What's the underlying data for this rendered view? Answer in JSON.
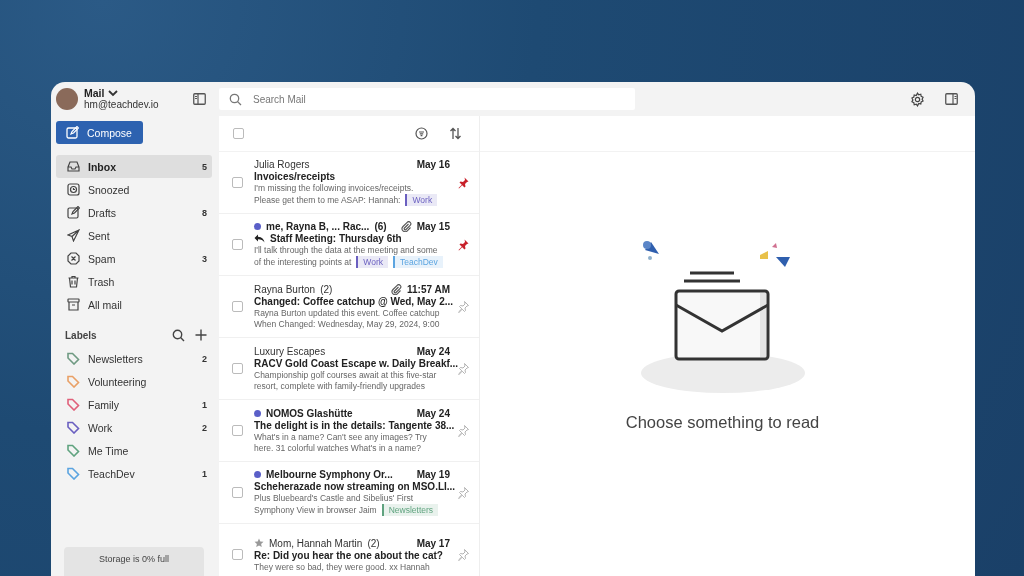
{
  "account": {
    "app": "Mail",
    "email": "hm@teachdev.io"
  },
  "compose": "Compose",
  "folders": [
    {
      "kind": "inbox",
      "label": "Inbox",
      "count": "5",
      "selected": true
    },
    {
      "kind": "snoozed",
      "label": "Snoozed",
      "selected": false
    },
    {
      "kind": "drafts",
      "label": "Drafts",
      "count": "8",
      "selected": false
    },
    {
      "kind": "sent",
      "label": "Sent",
      "selected": false
    },
    {
      "kind": "spam",
      "label": "Spam",
      "count": "3",
      "selected": false
    },
    {
      "kind": "trash",
      "label": "Trash",
      "selected": false
    },
    {
      "kind": "all",
      "label": "All mail",
      "selected": false
    }
  ],
  "labels_heading": "Labels",
  "labels": [
    {
      "label": "Newsletters",
      "count": "2",
      "color": "#6f9a82"
    },
    {
      "label": "Volunteering",
      "color": "#e9a066"
    },
    {
      "label": "Family",
      "count": "1",
      "color": "#e0607a"
    },
    {
      "label": "Work",
      "count": "2",
      "color": "#6a5fc0"
    },
    {
      "label": "Me Time",
      "color": "#5fa37f"
    },
    {
      "label": "TeachDev",
      "count": "1",
      "color": "#5ba4e0"
    }
  ],
  "storage": "Storage is 0% full",
  "search": {
    "placeholder": "Search Mail"
  },
  "select_all": {
    "checked": false
  },
  "emails": [
    {
      "sender": "Julia Rogers",
      "unread": false,
      "attachment": false,
      "date": "May 16",
      "subject": "Invoices/receipts",
      "reply": false,
      "starred": false,
      "preview": [
        "I'm missing the following invoices/receipts.",
        "Please get them to me ASAP: Hannah:"
      ],
      "tags": [
        {
          "label": "Work",
          "color": "#6a5fc0"
        }
      ],
      "pinned": true,
      "checked": false
    },
    {
      "sender": "me, Rayna B, ... Rac...",
      "count": "(6)",
      "unread": true,
      "attachment": true,
      "date": "May 15",
      "subject": "Staff Meeting: Thursday 6th",
      "reply": true,
      "starred": false,
      "preview": [
        "I'll talk through the data at the meeting and some",
        "of the interesting points at"
      ],
      "tags": [
        {
          "label": "Work",
          "color": "#6a5fc0"
        },
        {
          "label": "TeachDev",
          "color": "#5ba4e0"
        }
      ],
      "pinned": true,
      "checked": false
    },
    {
      "sender": "Rayna Burton",
      "count": "(2)",
      "unread": false,
      "attachment": true,
      "date": "11:57 AM",
      "subject": "Changed: Coffee catchup @ Wed, May 2...",
      "reply": false,
      "starred": false,
      "preview": [
        "Rayna Burton updated this event. Coffee catchup",
        "When Changed: Wednesday, May 29, 2024, 9:00"
      ],
      "pinned": false,
      "checked": false
    },
    {
      "sender": "Luxury Escapes",
      "unread": false,
      "attachment": false,
      "date": "May 24",
      "subject": "RACV Gold Coast Escape w. Daily Breakf...",
      "reply": false,
      "starred": false,
      "preview": [
        "Championship golf courses await at this five-star",
        "resort, complete with family-friendly upgrades"
      ],
      "pinned": false,
      "checked": false
    },
    {
      "sender": "NOMOS Glashütte",
      "unread": true,
      "attachment": false,
      "date": "May 24",
      "subject": "The delight is in the details: Tangente 38...",
      "reply": false,
      "starred": false,
      "preview": [
        "What's in a name? Can't see any images? Try",
        "here. 31 colorful watches What's in a name?"
      ],
      "pinned": false,
      "checked": false
    },
    {
      "sender": "Melbourne Symphony Or...",
      "unread": true,
      "attachment": false,
      "date": "May 19",
      "subject": "Scheherazade now streaming on MSO.LI...",
      "reply": false,
      "starred": false,
      "preview": [
        "Plus Bluebeard's Castle and Sibelius' First",
        "Symphony View in browser Jaim"
      ],
      "tags": [
        {
          "label": "Newsletters",
          "color": "#5fa37f"
        }
      ],
      "pinned": false,
      "checked": false
    },
    {
      "sender": "Mom, Hannah Martin",
      "count": "(2)",
      "unread": false,
      "attachment": false,
      "date": "May 17",
      "subject": "Re: Did you hear the one about the cat?",
      "reply": false,
      "starred": true,
      "preview": [
        "They were so bad, they were good. xx Hannah"
      ],
      "pinned": false,
      "checked": false
    }
  ],
  "empty_state": "Choose something to read"
}
